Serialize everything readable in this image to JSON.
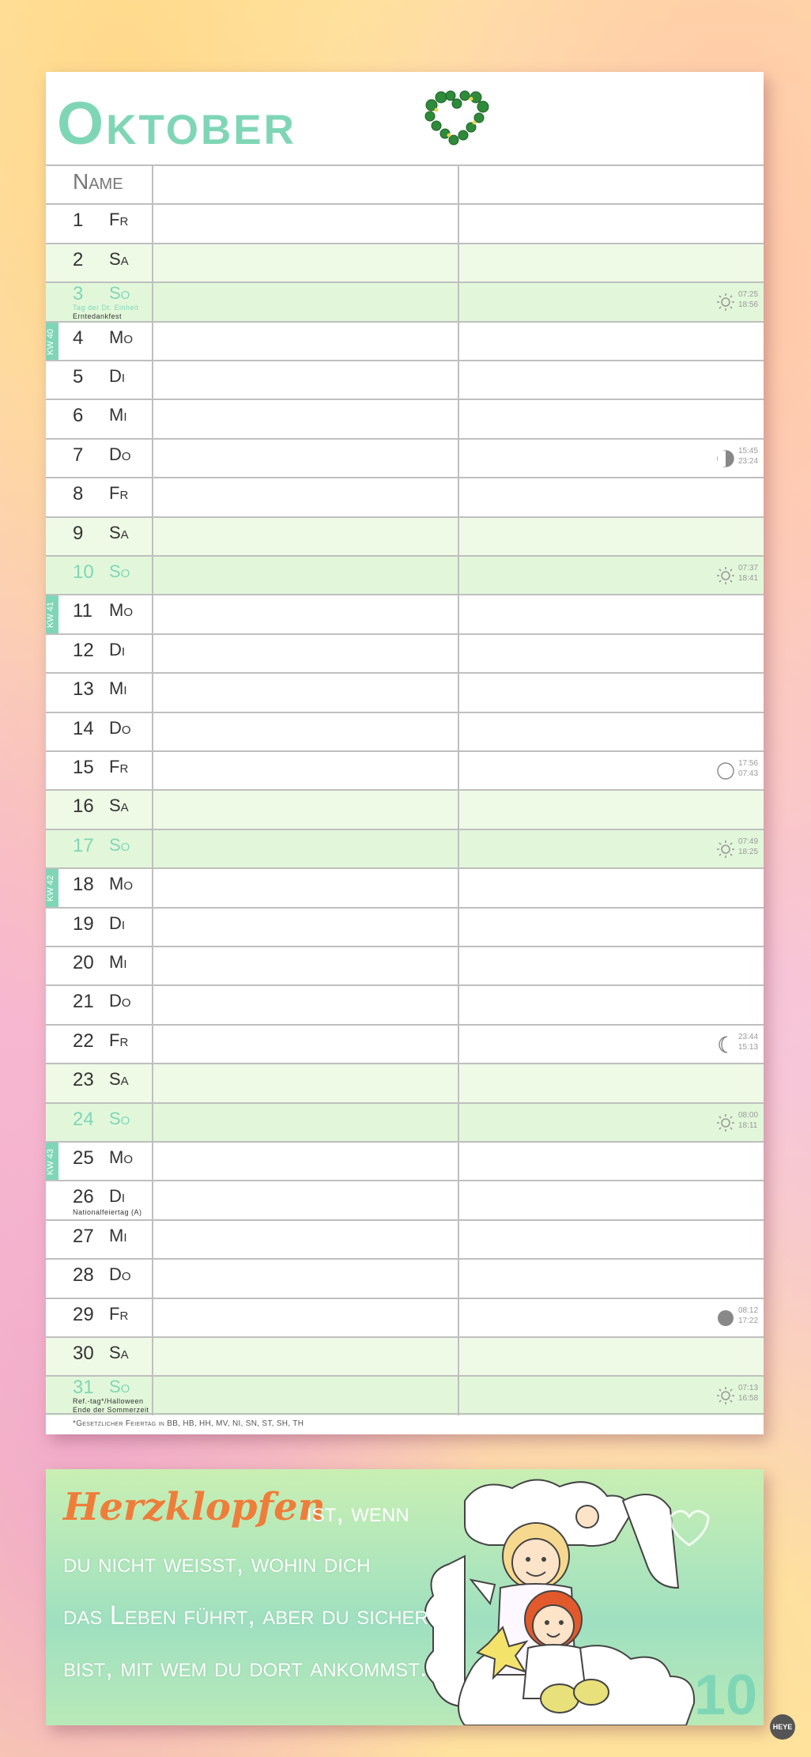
{
  "header": {
    "month": "Oktober",
    "name_label": "Name"
  },
  "colors": {
    "accent": "#7fd6b6",
    "weekend": "#e2f7da",
    "quote_orange": "#ef7d3a"
  },
  "days": [
    {
      "num": "1",
      "day": "Fr",
      "type": "weekday",
      "kw": "",
      "notes": [],
      "astro": null
    },
    {
      "num": "2",
      "day": "Sa",
      "type": "sat",
      "kw": "",
      "notes": [],
      "astro": null
    },
    {
      "num": "3",
      "day": "So",
      "type": "sun",
      "kw": "",
      "notes": [
        {
          "text": "Tag der Dt. Einheit",
          "green": true
        },
        {
          "text": "Erntedankfest",
          "green": false
        }
      ],
      "astro": {
        "icon": "sun-icon",
        "t1": "07:25",
        "t2": "18:56"
      }
    },
    {
      "num": "4",
      "day": "Mo",
      "type": "weekday",
      "kw": "KW 40",
      "notes": [],
      "astro": null
    },
    {
      "num": "5",
      "day": "Di",
      "type": "weekday",
      "kw": "",
      "notes": [],
      "astro": null
    },
    {
      "num": "6",
      "day": "Mi",
      "type": "weekday",
      "kw": "",
      "notes": [],
      "astro": null
    },
    {
      "num": "7",
      "day": "Do",
      "type": "weekday",
      "kw": "",
      "notes": [],
      "astro": {
        "icon": "half-moon-icon",
        "t1": "15:45",
        "t2": "23:24"
      }
    },
    {
      "num": "8",
      "day": "Fr",
      "type": "weekday",
      "kw": "",
      "notes": [],
      "astro": null
    },
    {
      "num": "9",
      "day": "Sa",
      "type": "sat",
      "kw": "",
      "notes": [],
      "astro": null
    },
    {
      "num": "10",
      "day": "So",
      "type": "sun",
      "kw": "",
      "notes": [],
      "astro": {
        "icon": "sun-icon",
        "t1": "07:37",
        "t2": "18:41"
      }
    },
    {
      "num": "11",
      "day": "Mo",
      "type": "weekday",
      "kw": "KW 41",
      "notes": [],
      "astro": null
    },
    {
      "num": "12",
      "day": "Di",
      "type": "weekday",
      "kw": "",
      "notes": [],
      "astro": null
    },
    {
      "num": "13",
      "day": "Mi",
      "type": "weekday",
      "kw": "",
      "notes": [],
      "astro": null
    },
    {
      "num": "14",
      "day": "Do",
      "type": "weekday",
      "kw": "",
      "notes": [],
      "astro": null
    },
    {
      "num": "15",
      "day": "Fr",
      "type": "weekday",
      "kw": "",
      "notes": [],
      "astro": {
        "icon": "full-moon-icon",
        "t1": "17:56",
        "t2": "07:43"
      }
    },
    {
      "num": "16",
      "day": "Sa",
      "type": "sat",
      "kw": "",
      "notes": [],
      "astro": null
    },
    {
      "num": "17",
      "day": "So",
      "type": "sun",
      "kw": "",
      "notes": [],
      "astro": {
        "icon": "sun-icon",
        "t1": "07:49",
        "t2": "18:25"
      }
    },
    {
      "num": "18",
      "day": "Mo",
      "type": "weekday",
      "kw": "KW 42",
      "notes": [],
      "astro": null
    },
    {
      "num": "19",
      "day": "Di",
      "type": "weekday",
      "kw": "",
      "notes": [],
      "astro": null
    },
    {
      "num": "20",
      "day": "Mi",
      "type": "weekday",
      "kw": "",
      "notes": [],
      "astro": null
    },
    {
      "num": "21",
      "day": "Do",
      "type": "weekday",
      "kw": "",
      "notes": [],
      "astro": null
    },
    {
      "num": "22",
      "day": "Fr",
      "type": "weekday",
      "kw": "",
      "notes": [],
      "astro": {
        "icon": "crescent-moon-icon",
        "t1": "23:44",
        "t2": "15:13"
      }
    },
    {
      "num": "23",
      "day": "Sa",
      "type": "sat",
      "kw": "",
      "notes": [],
      "astro": null
    },
    {
      "num": "24",
      "day": "So",
      "type": "sun",
      "kw": "",
      "notes": [],
      "astro": {
        "icon": "sun-icon",
        "t1": "08:00",
        "t2": "18:11"
      }
    },
    {
      "num": "25",
      "day": "Mo",
      "type": "weekday",
      "kw": "KW 43",
      "notes": [],
      "astro": null
    },
    {
      "num": "26",
      "day": "Di",
      "type": "weekday",
      "kw": "",
      "notes": [
        {
          "text": "Nationalfeiertag (A)",
          "green": false
        }
      ],
      "astro": null
    },
    {
      "num": "27",
      "day": "Mi",
      "type": "weekday",
      "kw": "",
      "notes": [],
      "astro": null
    },
    {
      "num": "28",
      "day": "Do",
      "type": "weekday",
      "kw": "",
      "notes": [],
      "astro": null
    },
    {
      "num": "29",
      "day": "Fr",
      "type": "weekday",
      "kw": "",
      "notes": [],
      "astro": {
        "icon": "new-moon-icon",
        "t1": "08:12",
        "t2": "17:22"
      }
    },
    {
      "num": "30",
      "day": "Sa",
      "type": "sat",
      "kw": "",
      "notes": [],
      "astro": null
    },
    {
      "num": "31",
      "day": "So",
      "type": "sun",
      "kw": "",
      "notes": [
        {
          "text": "Ref.-tag*/Halloween",
          "green": false
        },
        {
          "text": "Ende der Sommerzeit",
          "green": false
        }
      ],
      "astro": {
        "icon": "sun-icon",
        "t1": "07:13",
        "t2": "16:58"
      }
    }
  ],
  "footnote": "*Gesetzlicher Feiertag in BB, HB, HH, MV, NI, SN, ST, SH, TH",
  "quote": {
    "highlight": "Herzklopfen",
    "line1_rest": "ist, wenn",
    "line2": "du nicht weißt, wohin dich",
    "line3": "das Leben führt, aber du sicher",
    "line4": "bist, mit wem du dort ankommst."
  },
  "month_number": "10",
  "publisher": "HEYE"
}
